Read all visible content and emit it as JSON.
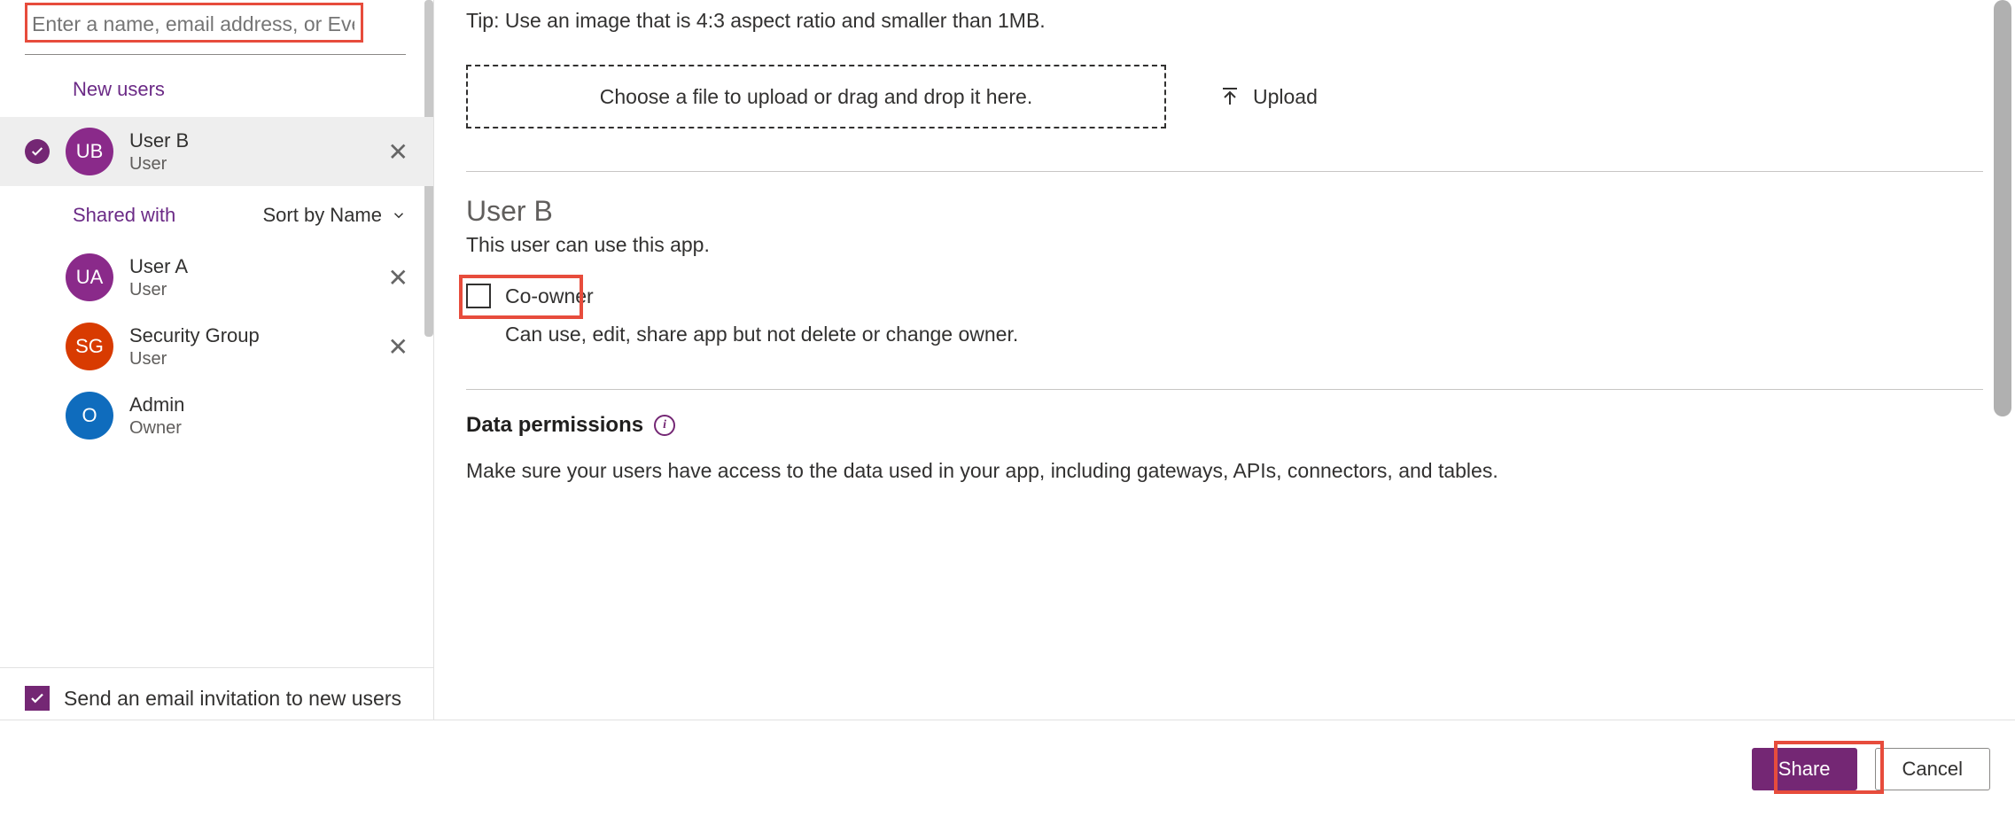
{
  "search": {
    "placeholder": "Enter a name, email address, or Everyone"
  },
  "sections": {
    "new_users": "New users",
    "shared_with": "Shared with",
    "sort_by": "Sort by Name"
  },
  "new_users_list": [
    {
      "initials": "UB",
      "name": "User B",
      "role": "User",
      "color": "purple",
      "selected": true
    }
  ],
  "shared_list": [
    {
      "initials": "UA",
      "name": "User A",
      "role": "User",
      "color": "purple",
      "removable": true
    },
    {
      "initials": "SG",
      "name": "Security Group",
      "role": "User",
      "color": "red",
      "removable": true
    },
    {
      "initials": "O",
      "name": "Admin",
      "role": "Owner",
      "color": "blue",
      "removable": false
    }
  ],
  "email_invite": {
    "checked": true,
    "label": "Send an email invitation to new users"
  },
  "tip": "Tip: Use an image that is 4:3 aspect ratio and smaller than 1MB.",
  "dropzone": "Choose a file to upload or drag and drop it here.",
  "upload_label": "Upload",
  "detail": {
    "name": "User B",
    "desc": "This user can use this app.",
    "coowner_label": "Co-owner",
    "coowner_desc": "Can use, edit, share app but not delete or change owner."
  },
  "permissions": {
    "heading": "Data permissions",
    "desc": "Make sure your users have access to the data used in your app, including gateways, APIs, connectors, and tables."
  },
  "footer": {
    "share": "Share",
    "cancel": "Cancel"
  },
  "highlight_color": "#e74c3c"
}
